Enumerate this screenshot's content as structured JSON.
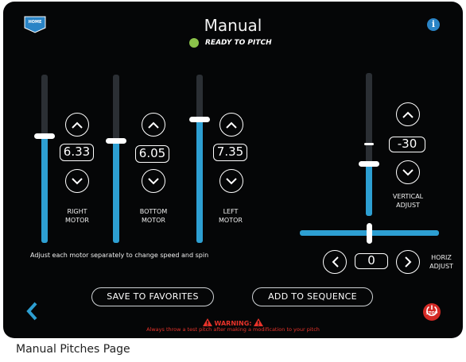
{
  "header": {
    "home_label": "HOME",
    "title": "Manual",
    "status": "READY TO PITCH",
    "info_symbol": "i"
  },
  "motors": [
    {
      "value": "6.33",
      "label_line1": "RIGHT",
      "label_line2": "MOTOR",
      "level": 0.62
    },
    {
      "value": "6.05",
      "label_line1": "BOTTOM",
      "label_line2": "MOTOR",
      "level": 0.6
    },
    {
      "value": "7.35",
      "label_line1": "LEFT",
      "label_line2": "MOTOR",
      "level": 0.73
    }
  ],
  "motor_hint": "Adjust each motor separately to change speed and spin",
  "vertical": {
    "value": "-30",
    "label_line1": "VERTICAL",
    "label_line2": "ADJUST",
    "level": 0.38
  },
  "horizontal": {
    "value": "0",
    "label_line1": "HORIZ",
    "label_line2": "ADJUST",
    "level": 0.5
  },
  "buttons": {
    "save": "SAVE TO FAVORITES",
    "add": "ADD TO SEQUENCE",
    "stop": "STOP"
  },
  "warning": {
    "title": "WARNING:",
    "text": "Always throw a test pitch after making a modification to your pitch"
  },
  "caption": "Manual Pitches Page",
  "colors": {
    "accent": "#2d9fd2",
    "ready": "#8bc34a",
    "warning": "#e8332a",
    "info": "#2a84c6"
  },
  "icons": [
    "home-icon",
    "info-icon",
    "chevron-up-icon",
    "chevron-down-icon",
    "chevron-left-icon",
    "chevron-right-icon",
    "back-arrow-icon",
    "warning-icon",
    "stop-icon"
  ]
}
